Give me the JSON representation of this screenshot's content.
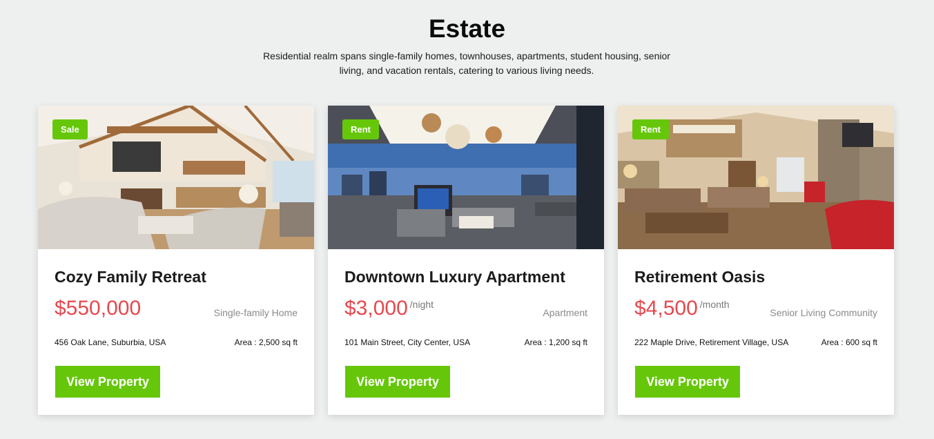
{
  "header": {
    "title": "Estate",
    "subtitle": "Residential realm spans single-family homes, townhouses, apartments, student housing, senior living, and vacation rentals, catering to various living needs."
  },
  "colors": {
    "accent_green": "#66c70a",
    "price_red": "#e5484d",
    "background": "#eef0f0"
  },
  "properties": [
    {
      "badge": "Sale",
      "title": "Cozy Family Retreat",
      "price": "$550,000",
      "price_unit": "",
      "type": "Single-family Home",
      "address": "456 Oak Lane, Suburbia, USA",
      "area": "Area : 2,500 sq ft",
      "button_label": "View Property",
      "image_icon": "living-room-photo"
    },
    {
      "badge": "Rent",
      "title": "Downtown Luxury Apartment",
      "price": "$3,000",
      "price_unit": "/night",
      "type": "Apartment",
      "address": "101 Main Street, City Center, USA",
      "area": "Area : 1,200 sq ft",
      "button_label": "View Property",
      "image_icon": "penthouse-lounge-photo"
    },
    {
      "badge": "Rent",
      "title": "Retirement Oasis",
      "price": "$4,500",
      "price_unit": "/month",
      "type": "Senior Living Community",
      "address": "222 Maple Drive, Retirement Village, USA",
      "area": "Area : 600 sq ft",
      "button_label": "View Property",
      "image_icon": "lodge-great-room-photo"
    }
  ]
}
